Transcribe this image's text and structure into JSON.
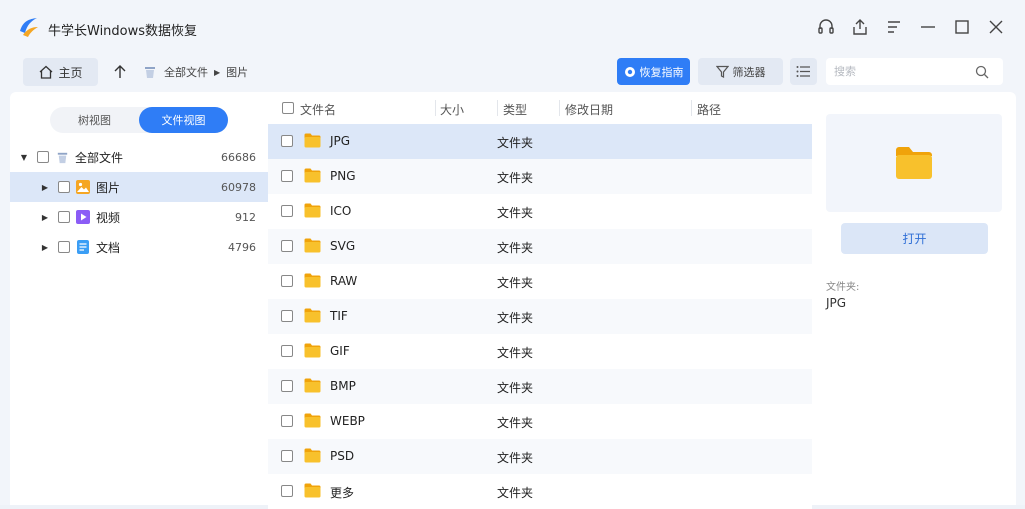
{
  "app": {
    "title": "牛学长Windows数据恢复",
    "accent": "#2f7df6"
  },
  "window_controls": [
    "headset-icon",
    "share-icon",
    "menu-icon",
    "minimize-icon",
    "maximize-icon",
    "close-icon"
  ],
  "toolbar": {
    "home_label": "主页",
    "breadcrumb": [
      "全部文件",
      "图片"
    ],
    "guide_label": "恢复指南",
    "filter_label": "筛选器",
    "search_placeholder": "搜索"
  },
  "left": {
    "views": [
      "树视图",
      "文件视图"
    ],
    "active_view": 1,
    "tree": [
      {
        "label": "全部文件",
        "count": "66686",
        "icon": "all-files-icon",
        "level": 0,
        "expanded": true,
        "selected": false
      },
      {
        "label": "图片",
        "count": "60978",
        "icon": "image-icon",
        "level": 1,
        "expanded": false,
        "selected": true
      },
      {
        "label": "视频",
        "count": "912",
        "icon": "video-icon",
        "level": 1,
        "expanded": false,
        "selected": false
      },
      {
        "label": "文档",
        "count": "4796",
        "icon": "document-icon",
        "level": 1,
        "expanded": false,
        "selected": false
      }
    ]
  },
  "table": {
    "columns": [
      "文件名",
      "大小",
      "类型",
      "修改日期",
      "路径"
    ],
    "rows": [
      {
        "name": "JPG",
        "type": "文件夹"
      },
      {
        "name": "PNG",
        "type": "文件夹"
      },
      {
        "name": "ICO",
        "type": "文件夹"
      },
      {
        "name": "SVG",
        "type": "文件夹"
      },
      {
        "name": "RAW",
        "type": "文件夹"
      },
      {
        "name": "TIF",
        "type": "文件夹"
      },
      {
        "name": "GIF",
        "type": "文件夹"
      },
      {
        "name": "BMP",
        "type": "文件夹"
      },
      {
        "name": "WEBP",
        "type": "文件夹"
      },
      {
        "name": "PSD",
        "type": "文件夹"
      },
      {
        "name": "更多",
        "type": "文件夹"
      }
    ],
    "selected_row": 0
  },
  "detail": {
    "open_label": "打开",
    "info_label": "文件夹:",
    "info_value": "JPG"
  }
}
